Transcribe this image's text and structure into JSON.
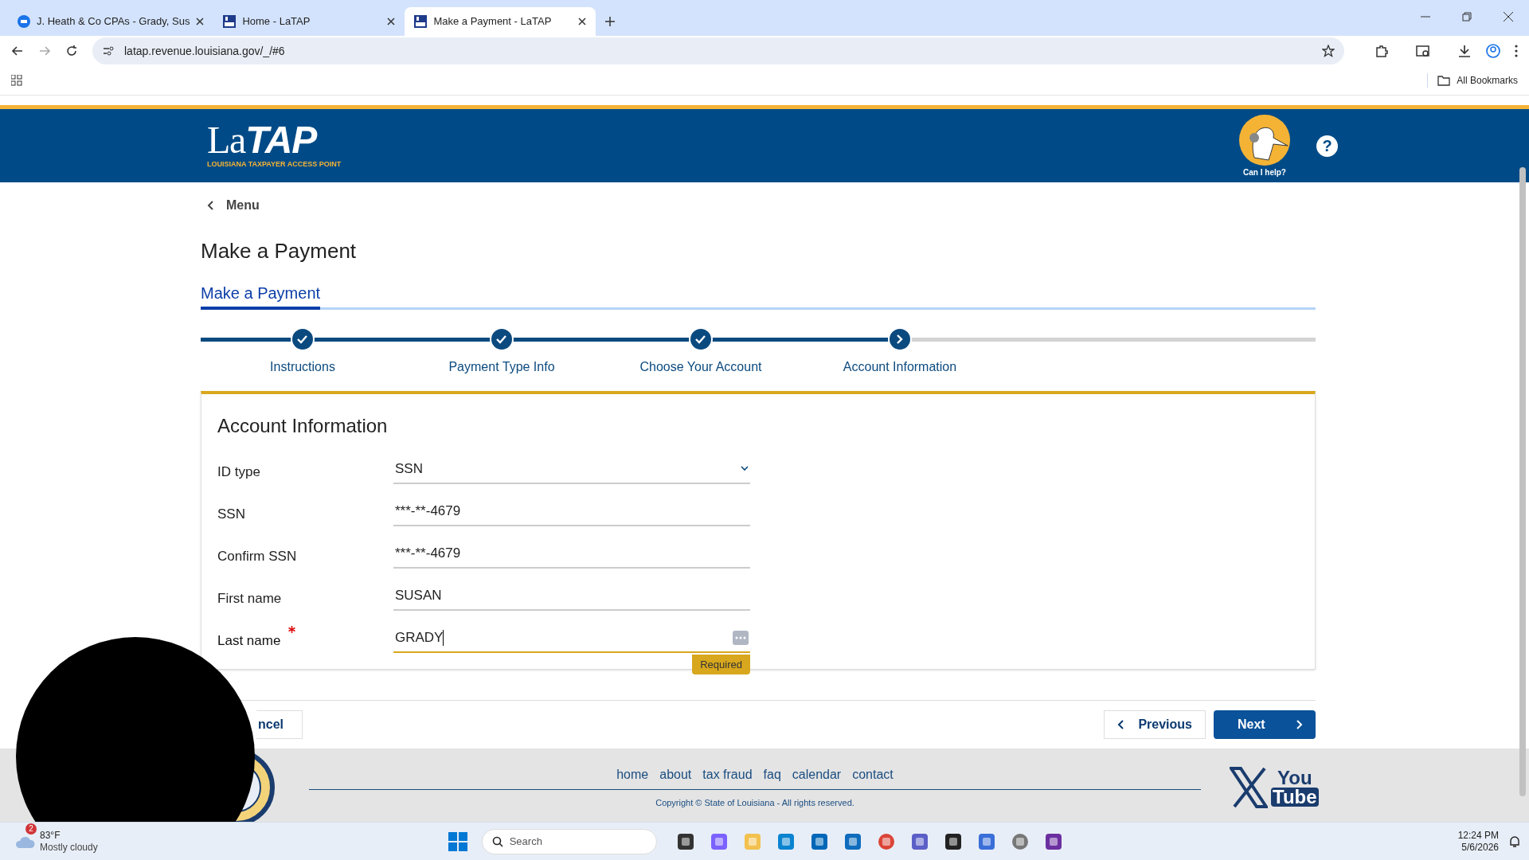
{
  "browser": {
    "tabs": [
      {
        "title": "J. Heath & Co CPAs - Grady, Sus",
        "kind": "td",
        "selected": false
      },
      {
        "title": "Home - LaTAP",
        "kind": "latap",
        "selected": false
      },
      {
        "title": "Make a Payment - LaTAP",
        "kind": "latap",
        "selected": true
      }
    ],
    "url": "latap.revenue.louisiana.gov/_/#6",
    "bookmarks_label": "All Bookmarks"
  },
  "header": {
    "logo_la": "La",
    "logo_tap": "TAP",
    "logo_subtitle": "LOUISIANA TAXPAYER ACCESS POINT",
    "help_label": "Can I help?",
    "help_icon": "?"
  },
  "page": {
    "back_label": "Menu",
    "title": "Make a Payment",
    "section_tabs": [
      {
        "label": "Make a Payment",
        "selected": true
      }
    ],
    "steps": [
      {
        "label": "Instructions",
        "done": true
      },
      {
        "label": "Payment Type Info",
        "done": true
      },
      {
        "label": "Choose Your Account",
        "done": true
      },
      {
        "label": "Account Information",
        "done": false
      }
    ],
    "form": {
      "title": "Account Information",
      "fields": [
        {
          "label": "ID type",
          "value": "SSN",
          "kind": "select",
          "required": false,
          "focused": false
        },
        {
          "label": "SSN",
          "value": "***-**-4679",
          "kind": "input",
          "required": false,
          "focused": false
        },
        {
          "label": "Confirm SSN",
          "value": "***-**-4679",
          "kind": "input",
          "required": false,
          "focused": false
        },
        {
          "label": "First name",
          "value": "SUSAN",
          "kind": "input",
          "required": false,
          "focused": false
        },
        {
          "label": "Last name",
          "value": "GRADY",
          "kind": "input",
          "required": true,
          "focused": true,
          "message": "Required"
        }
      ]
    },
    "buttons": {
      "cancel": "ncel",
      "previous": "Previous",
      "next": "Next"
    }
  },
  "footer": {
    "links": [
      "home",
      "about",
      "tax fraud",
      "faq",
      "calendar",
      "contact"
    ],
    "copyright": "Copyright © State of Louisiana - All rights reserved.",
    "youtube_top": "You",
    "youtube_bottom": "Tube"
  },
  "taskbar": {
    "weather_badge": "2",
    "temperature": "83°F",
    "condition": "Mostly cloudy",
    "search_placeholder": "Search",
    "time": "12:24 PM",
    "date": "5/6/2026"
  }
}
